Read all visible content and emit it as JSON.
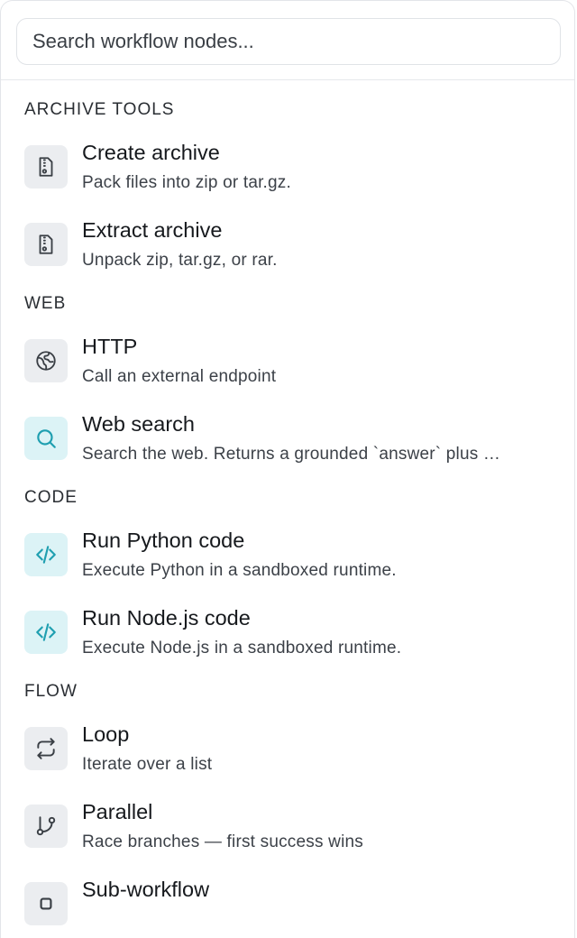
{
  "search": {
    "placeholder": "Search workflow nodes...",
    "value": ""
  },
  "colors": {
    "icon_gray_bg": "#ebedf0",
    "icon_teal_bg": "#dcf3f6",
    "icon_gray_fg": "#3a3f45",
    "icon_teal_fg": "#1f9fb0"
  },
  "sections": [
    {
      "title": "ARCHIVE TOOLS",
      "items": [
        {
          "name": "Create archive",
          "desc": "Pack files into zip or tar.gz.",
          "icon": "archive-file-icon"
        },
        {
          "name": "Extract archive",
          "desc": "Unpack zip, tar.gz, or rar.",
          "icon": "archive-file-icon"
        }
      ]
    },
    {
      "title": "WEB",
      "items": [
        {
          "name": "HTTP",
          "desc": "Call an external endpoint",
          "icon": "globe-icon"
        },
        {
          "name": "Web search",
          "desc": "Search the web. Returns a grounded `answer` plus …",
          "icon": "search-icon"
        }
      ]
    },
    {
      "title": "CODE",
      "items": [
        {
          "name": "Run Python code",
          "desc": "Execute Python in a sandboxed runtime.",
          "icon": "code-icon"
        },
        {
          "name": "Run Node.js code",
          "desc": "Execute Node.js in a sandboxed runtime.",
          "icon": "code-icon"
        }
      ]
    },
    {
      "title": "FLOW",
      "items": [
        {
          "name": "Loop",
          "desc": "Iterate over a list",
          "icon": "repeat-icon"
        },
        {
          "name": "Parallel",
          "desc": "Race branches — first success wins",
          "icon": "git-branch-icon"
        },
        {
          "name": "Sub-workflow",
          "desc": "",
          "icon": "square-icon"
        }
      ]
    }
  ]
}
